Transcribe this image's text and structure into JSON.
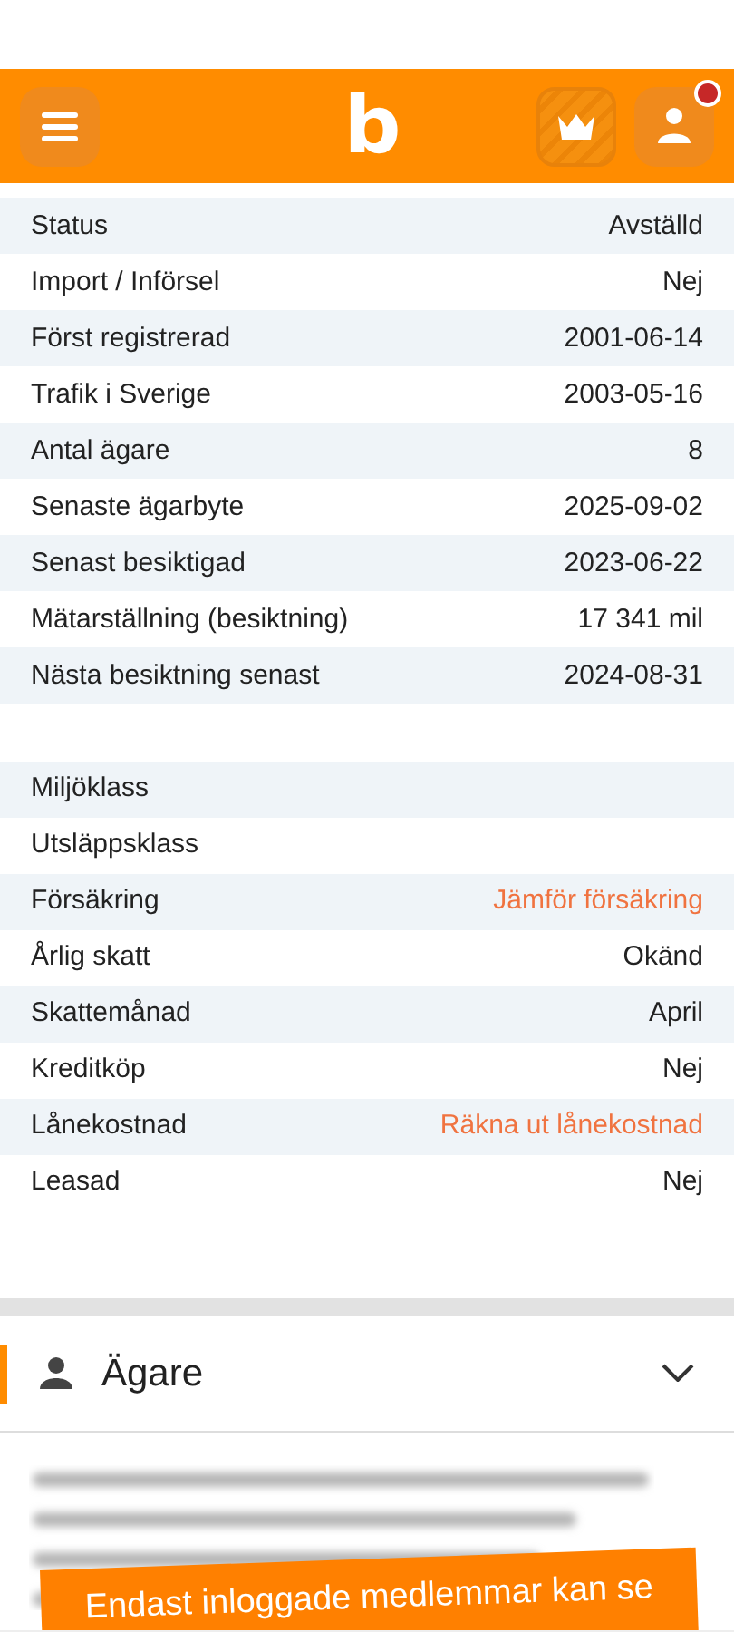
{
  "header": {
    "logo": "b",
    "notification": true
  },
  "details": [
    {
      "label": "Status",
      "value": "Avställd",
      "kind": "plain"
    },
    {
      "label": "Import / Införsel",
      "value": "Nej",
      "kind": "plain"
    },
    {
      "label": "Först registrerad",
      "value": "2001-06-14",
      "kind": "plain"
    },
    {
      "label": "Trafik i Sverige",
      "value": "2003-05-16",
      "kind": "plain"
    },
    {
      "label": "Antal ägare",
      "value": "8",
      "kind": "plain"
    },
    {
      "label": "Senaste ägarbyte",
      "value": "2025-09-02",
      "kind": "plain"
    },
    {
      "label": "Senast besiktigad",
      "value": "2023-06-22",
      "kind": "plain"
    },
    {
      "label": "Mätarställning (besiktning)",
      "value": "17 341 mil",
      "kind": "plain"
    },
    {
      "label": "Nästa besiktning senast",
      "value": "2024-08-31",
      "kind": "plain"
    }
  ],
  "details_2": [
    {
      "label": "Miljöklass"
    },
    {
      "label": "Utsläppsklass"
    },
    {
      "label": "Försäkring",
      "value": "Jämför försäkring",
      "kind": "link"
    },
    {
      "label": "Årlig skatt",
      "value": "Okänd",
      "kind": "plain"
    },
    {
      "label": "Skattemånad",
      "value": "April",
      "kind": "plain"
    },
    {
      "label": "Kreditköp",
      "value": "Nej",
      "kind": "plain"
    },
    {
      "label": "Lånekostnad",
      "value": "Räkna ut lånekostnad",
      "kind": "link"
    },
    {
      "label": "Leasad",
      "value": "Nej",
      "kind": "plain"
    }
  ],
  "owner_section": {
    "title": "Ägare",
    "expanded": false,
    "banner": "Endast inloggade medlemmar kan se"
  }
}
